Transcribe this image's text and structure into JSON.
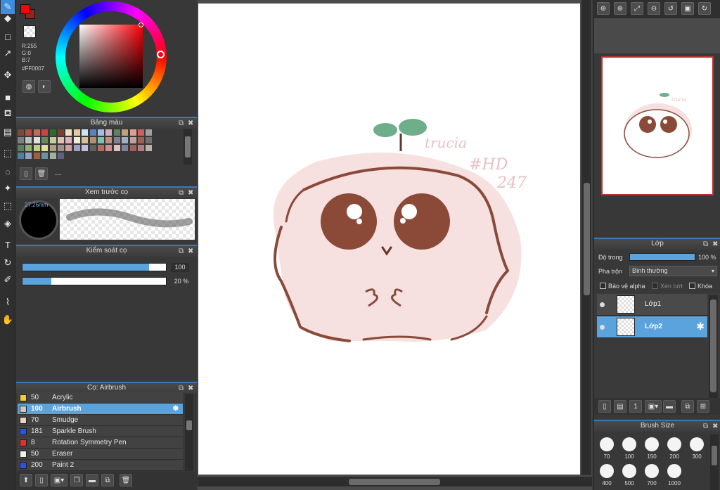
{
  "tools": [
    {
      "name": "pen-tool-icon",
      "glyph": "✎"
    },
    {
      "name": "eraser-tool-icon",
      "glyph": "◆"
    },
    {
      "name": "rectangle-tool-icon",
      "glyph": "□"
    },
    {
      "name": "brush-tool-icon",
      "glyph": "↗"
    },
    {
      "name": "move-tool-icon",
      "glyph": "✥"
    },
    {
      "name": "fill-rect-tool-icon",
      "glyph": "■"
    },
    {
      "name": "bucket-tool-icon",
      "glyph": "⛾"
    },
    {
      "name": "gradient-tool-icon",
      "glyph": "▤"
    },
    {
      "name": "select-rect-tool-icon",
      "glyph": "⬚"
    },
    {
      "name": "lasso-tool-icon",
      "glyph": "◌"
    },
    {
      "name": "magic-wand-tool-icon",
      "glyph": "✦"
    },
    {
      "name": "select-pen-tool-icon",
      "glyph": "⬚"
    },
    {
      "name": "select-eraser-tool-icon",
      "glyph": "◈"
    },
    {
      "name": "text-tool-icon",
      "glyph": "T"
    },
    {
      "name": "transform-tool-icon",
      "glyph": "↻"
    },
    {
      "name": "eyedropper-tool-icon",
      "glyph": "✐"
    },
    {
      "name": "dropper-tool-icon",
      "glyph": "⌇"
    },
    {
      "name": "hand-tool-icon",
      "glyph": "✋"
    }
  ],
  "color_picker": {
    "r_label": "R:255",
    "g_label": "G:0",
    "b_label": "B:7",
    "hex_label": "#FF0007",
    "primary_color": "#ff0007",
    "secondary_color": "#8a2a1a"
  },
  "palette_panel": {
    "title": "Bảng màu",
    "footer_text": "---",
    "colors": [
      "#7a4a3a",
      "#b05040",
      "#c06a5a",
      "#d04040",
      "#2e6b2e",
      "#7a4030",
      "#f0e0c0",
      "#e8c8a0",
      "#c8e8f0",
      "#6080c0",
      "#a0c0e0",
      "#d0b0c0",
      "#608060",
      "#c0a080",
      "#e0a090",
      "#d06060",
      "#a0a0a0",
      "#808080",
      "#c0c0c0",
      "#e0e0e0",
      "#6a8a5a",
      "#c0d0a0",
      "#e0c0b0",
      "#e0b0c0",
      "#f0f0d0",
      "#d0c0a0",
      "#b09070",
      "#80c0b0",
      "#c09080",
      "#808090",
      "#a0b0c0",
      "#c0a0a0",
      "#a06050",
      "#707070",
      "#5a8060",
      "#90b070",
      "#c0d080",
      "#e0e0a0",
      "#b0a080",
      "#a09090",
      "#d0a0a0",
      "#a0a0c0",
      "#c0c0e0",
      "#606060",
      "#b07060",
      "#d09090",
      "#e0c0c0",
      "#8080a0",
      "#a06060",
      "#b08080",
      "#c0b0a0",
      "#5080a0",
      "#90a0c0",
      "#a06040",
      "#7090a0",
      "#a0b0a0",
      "#606080"
    ]
  },
  "brush_preview": {
    "title": "Xem trước cọ",
    "size_label": "27.26mm"
  },
  "brush_control": {
    "title": "Kiểm soát cọ",
    "size_value": "100",
    "opacity_value": "20 %",
    "size_fraction": 0.88,
    "opacity_fraction": 0.2
  },
  "brush_list": {
    "title": "Cọ: Airbrush",
    "items": [
      {
        "size": "50",
        "name": "Acrylic",
        "color": "#f0d020",
        "selected": false
      },
      {
        "size": "100",
        "name": "Airbrush",
        "color": "#c8c8c8",
        "selected": true
      },
      {
        "size": "70",
        "name": "Smudge",
        "color": "#f0d0c0",
        "selected": false
      },
      {
        "size": "181",
        "name": "Sparkle Brush",
        "color": "#3050e0",
        "selected": false
      },
      {
        "size": "8",
        "name": "Rotation Symmetry Pen",
        "color": "#e03030",
        "selected": false
      },
      {
        "size": "50",
        "name": "Eraser",
        "color": "#f0f0f0",
        "selected": false
      },
      {
        "size": "200",
        "name": "Paint 2",
        "color": "#3050e0",
        "selected": false
      }
    ]
  },
  "navigator": {
    "buttons": [
      "zoom-in-icon",
      "zoom-in-icon",
      "fit-icon",
      "zoom-out-icon",
      "rotate-left-icon",
      "fullscreen-icon",
      "rotate-right-icon"
    ]
  },
  "layer_panel": {
    "title": "Lớp",
    "opacity_label": "Độ trong",
    "opacity_value": "100 %",
    "blend_label": "Pha trộn",
    "blend_value": "Bình thường",
    "protect_alpha_label": "Bảo vệ alpha",
    "clipping_label": "Xén bớt",
    "lock_label": "Khóa",
    "layers": [
      {
        "name": "Lớp1",
        "selected": false
      },
      {
        "name": "Lớp2",
        "selected": true
      }
    ]
  },
  "brush_size_panel": {
    "title": "Brush Size",
    "sizes": [
      "70",
      "100",
      "150",
      "200",
      "300",
      "400",
      "500",
      "700",
      "1000"
    ]
  }
}
